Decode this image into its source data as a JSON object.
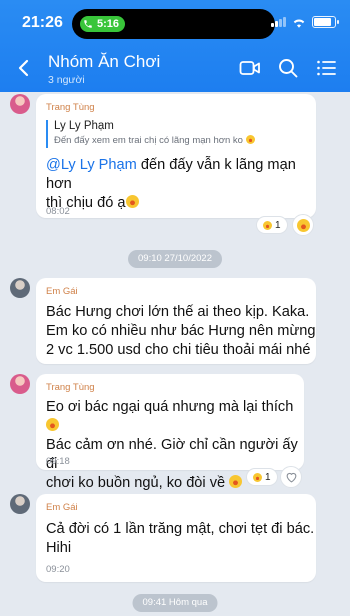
{
  "status": {
    "clock": "21:26",
    "call_time": "5:16",
    "battery_level": 0.85
  },
  "header": {
    "title": "Nhóm Ăn Chơi",
    "subtitle": "3 người",
    "icons": [
      "back-arrow-icon",
      "video-call-icon",
      "search-icon",
      "menu-list-icon"
    ]
  },
  "messages": [
    {
      "sender": "Trang Tùng",
      "quote_name": "Ly Ly Phạm",
      "quote_text": "Đến đấy xem em trai chị có lãng mạn hơn ko",
      "mention": "@Ly Ly Phạm",
      "line1": " đến đấy vẫn k lãng mạn hơn",
      "line2": "thì chịu đó ạ",
      "time": "08:02",
      "reaction_count": "1"
    },
    {
      "sender": "Em Gái",
      "lines": [
        "Bác Hưng chơi lớn thế ai theo kịp. Kaka.",
        "Em ko có nhiều như bác Hưng nên mừng",
        "2 vc 1.500 usd cho chi tiêu thoải mái nhé"
      ]
    },
    {
      "sender": "Trang Tùng",
      "lines": [
        "Eo ơi bác ngại quá nhưng mà lại thích",
        "Bác cảm ơn nhé. Giờ chỉ cần người ấy đi",
        "chơi ko buồn ngủ, ko đòi về"
      ],
      "time": "09:18",
      "reaction_count": "1"
    },
    {
      "sender": "Em Gái",
      "lines": [
        "Cả đời có 1 lần trăng mật, chơi tẹt đi bác.",
        "Hihi"
      ],
      "time": "09:20"
    }
  ],
  "dividers": [
    "09:10 27/10/2022",
    "09:41 Hôm qua"
  ],
  "colors": {
    "header_blue": "#2a8cf3",
    "background": "#e4e9f0",
    "sender_orange": "#d0824a",
    "mention_blue": "#1a73e8"
  }
}
